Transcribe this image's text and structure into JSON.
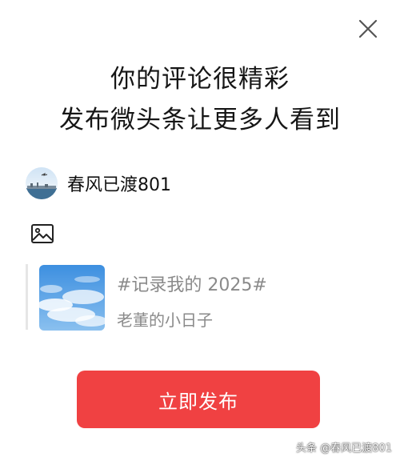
{
  "dialog": {
    "title_line1": "你的评论很精彩",
    "title_line2": "发布微头条让更多人看到",
    "close_icon": "close-icon"
  },
  "user": {
    "name": "春风已渡801",
    "avatar_icon": "avatar"
  },
  "composer": {
    "image_picker_icon": "image-icon"
  },
  "quoted": {
    "title": "#记录我的 2025#",
    "subtitle": "老董的小日子"
  },
  "actions": {
    "publish_label": "立即发布"
  },
  "watermark": {
    "text": "头条 @春风已渡801"
  },
  "colors": {
    "accent": "#f04142",
    "muted_text": "#8a8a8a",
    "divider": "#e6e6e6"
  }
}
